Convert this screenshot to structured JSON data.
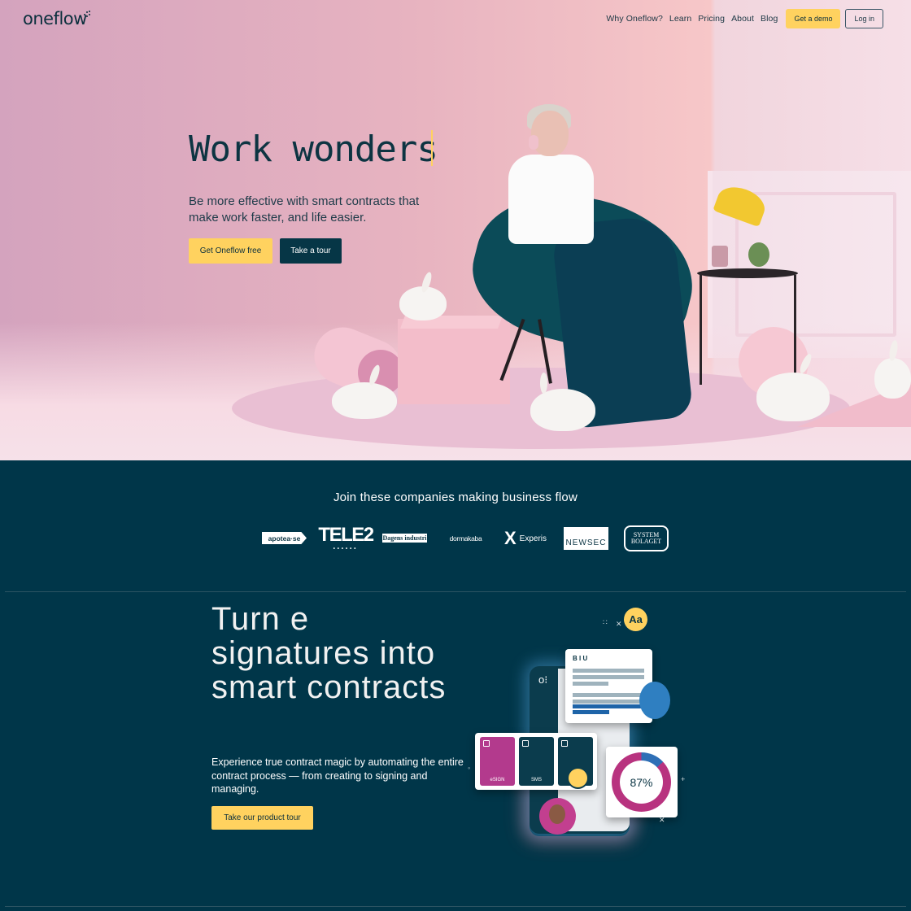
{
  "header": {
    "logo_text": "oneflow",
    "nav": [
      "Why Oneflow?",
      "Learn",
      "Pricing",
      "About",
      "Blog"
    ],
    "demo_label": "Get a demo",
    "login_label": "Log in"
  },
  "hero": {
    "title": "Work wonders",
    "subtitle": "Be more effective with smart contracts that make work faster, and life easier.",
    "primary_cta": "Get Oneflow free",
    "secondary_cta": "Take a tour"
  },
  "customers": {
    "title": "Join these companies making business flow",
    "logos": {
      "apotea": "apotea·se",
      "tele2": "TELE2",
      "tele2_dots": "••••••",
      "dagens": "Dagens industri",
      "dormakaba": "dormakaba",
      "experis_x": "X",
      "experis": "Experis",
      "newsec": "NEWSEC",
      "systembolaget_1": "SYSTEM",
      "systembolaget_2": "BOLAGET"
    }
  },
  "feature": {
    "title": "Turn e signatures into smart contracts",
    "subtitle": "Experience true contract magic by automating the entire contract process — from creating to signing and managing.",
    "cta": "Take our product tour",
    "illustration": {
      "format_badge": "Aa",
      "toolbar": "B I U",
      "card_sign": "eSIGN",
      "card_sms": "SMS",
      "donut_value": "87%",
      "donut_fraction": 0.87
    }
  },
  "colors": {
    "brand_navy": "#003649",
    "accent_yellow": "#ffd25f",
    "hero_pink": "#e7b3c0",
    "accent_magenta": "#b8337f"
  }
}
